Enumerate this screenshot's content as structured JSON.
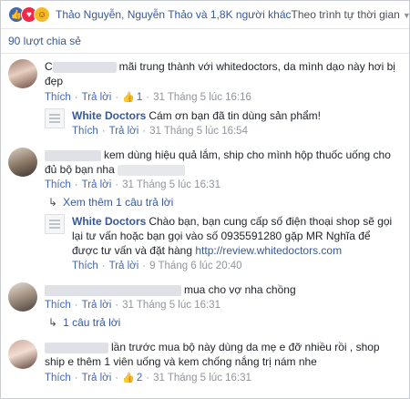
{
  "header": {
    "reactions": [
      "like-icon",
      "love-icon",
      "haha-icon"
    ],
    "likers_text": "Thảo Nguyễn, Nguyễn Thảo và 1,8K người khác",
    "sort_label": "Theo trình tự thời gian"
  },
  "shares_text": "90 lượt chia sẻ",
  "labels": {
    "like": "Thích",
    "reply": "Trả lời"
  },
  "comments": [
    {
      "name_prefix": "C",
      "text": "mãi trung thành với whitedoctors, da mình dạo này hơi bị đẹp",
      "likes": "1",
      "time": "31 Tháng 5 lúc 16:16",
      "reply": {
        "page": "White Doctors",
        "text": "Cám ơn bạn đã tin dùng sản phẩm!",
        "time": "31 Tháng 5 lúc 16:54"
      }
    },
    {
      "text": "kem dùng hiệu quả lắm, ship cho mình hộp thuốc uống cho đủ bộ bạn nha",
      "time": "31 Tháng 5 lúc 16:31",
      "more_replies": "Xem thêm 1 câu trả lời",
      "reply": {
        "page": "White Doctors",
        "text": "Chào bạn, bạn cung cấp số điện thoại shop sẽ gọi lại tư vấn hoặc bạn gọi vào số 0935591280 gặp MR Nghĩa để được tư vấn và đặt hàng",
        "link": "http://review.whitedoctors.com",
        "time": "9 Tháng 6 lúc 20:40"
      }
    },
    {
      "text": "mua cho vợ nha chồng",
      "time": "31 Tháng 5 lúc 16:31",
      "more_replies": "1 câu trả lời"
    },
    {
      "text": "lần trước mua bộ này dùng da mẹ e đỡ nhiều rồi , shop ship e thêm 1 viên uống và kem chống nắng trị nám nhe",
      "likes": "2",
      "time": "31 Tháng 5 lúc 16:31"
    }
  ]
}
